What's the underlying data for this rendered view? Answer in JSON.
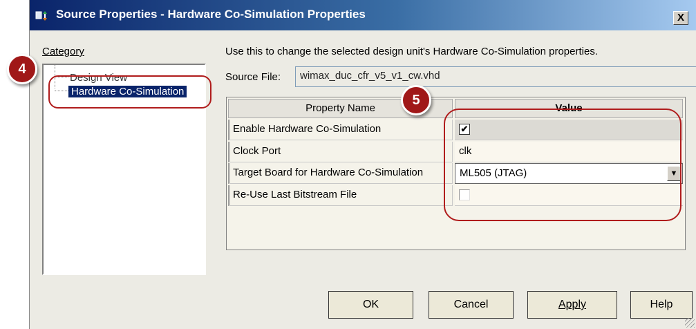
{
  "window": {
    "title": "Source Properties - Hardware Co-Simulation Properties",
    "close_glyph": "X"
  },
  "category": {
    "label": "Category",
    "items": [
      {
        "label": "Design View"
      },
      {
        "label": "Hardware Co-Simulation",
        "selected": true
      }
    ]
  },
  "description": "Use this to change the selected design unit's Hardware Co-Simulation properties.",
  "source_file": {
    "label": "Source File:",
    "value": "wimax_duc_cfr_v5_v1_cw.vhd"
  },
  "properties_table": {
    "columns": [
      "Property Name",
      "Value"
    ],
    "rows": [
      {
        "name": "Enable Hardware Co-Simulation",
        "value": "checked"
      },
      {
        "name": "Clock Port",
        "value": "clk"
      },
      {
        "name": "Target Board for Hardware Co-Simulation",
        "value": "ML505 (JTAG)"
      },
      {
        "name": "Re-Use Last Bitstream File",
        "value": "unchecked"
      }
    ]
  },
  "buttons": {
    "ok": "OK",
    "cancel": "Cancel",
    "apply": "Apply",
    "help": "Help"
  },
  "annotations": {
    "marker_4": "4",
    "marker_5": "5"
  },
  "colors": {
    "title_bar": "#0a246a",
    "selection": "#0a246a",
    "callout": "#b01c1c"
  },
  "icons": {
    "window": "app-icon",
    "checkmark": "check-icon",
    "dropdown": "chevron-down-icon"
  }
}
